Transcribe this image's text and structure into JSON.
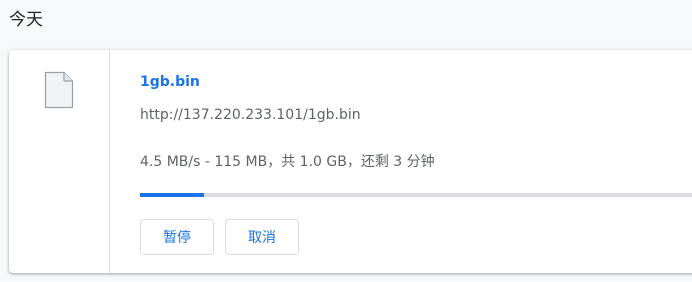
{
  "section": {
    "header": "今天"
  },
  "download": {
    "file_name": "1gb.bin",
    "url": "http://137.220.233.101/1gb.bin",
    "status": "4.5 MB/s - 115 MB，共 1.0 GB，还剩 3 分钟",
    "progress_fraction": 0.115,
    "icon": "file-icon",
    "actions": {
      "pause_label": "暂停",
      "cancel_label": "取消"
    }
  },
  "colors": {
    "accent": "#1a73e8",
    "track": "#dadce0",
    "secondary_text": "#5f6368",
    "background": "#f8f9fa"
  }
}
